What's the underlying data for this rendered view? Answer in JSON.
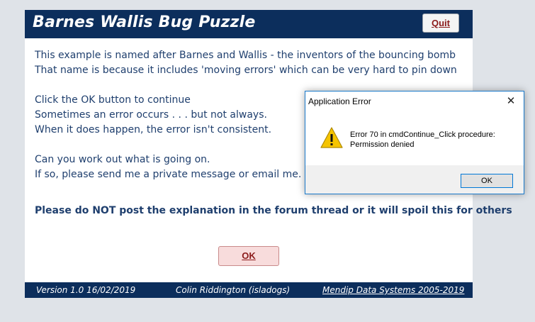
{
  "form": {
    "title": "Barnes Wallis Bug Puzzle",
    "quit_label": "Quit",
    "intro_lines": [
      "This example is named after Barnes and Wallis - the inventors of the bouncing bomb",
      "That name is because it includes 'moving errors' which can be very hard to pin down"
    ],
    "instruction_lines": [
      "Click the OK button to continue",
      "Sometimes an error occurs . . . but not always.",
      "When it does happen, the error isn't consistent."
    ],
    "question_lines": [
      "Can you work out what is going on.",
      "If so, please send me a private message or email me."
    ],
    "warning": "Please do NOT post the explanation in the forum thread or it will spoil this for others",
    "ok_label": "OK",
    "footer": {
      "version": "Version 1.0  16/02/2019",
      "author": "Colin Riddington (isladogs)",
      "company": "Mendip Data Systems 2005-2019"
    }
  },
  "dialog": {
    "title": "Application Error",
    "close_glyph": "✕",
    "message_line1": "Error 70 in cmdContinue_Click procedure:",
    "message_line2": "Permission denied",
    "ok_label": "OK",
    "icon": "warning-icon"
  },
  "colors": {
    "header_bg": "#0c2e5c",
    "body_text": "#1f3f6e",
    "button_text": "#8b1a1a",
    "ok_button_bg": "#f8dcdc",
    "warning_yellow": "#f5c400"
  }
}
